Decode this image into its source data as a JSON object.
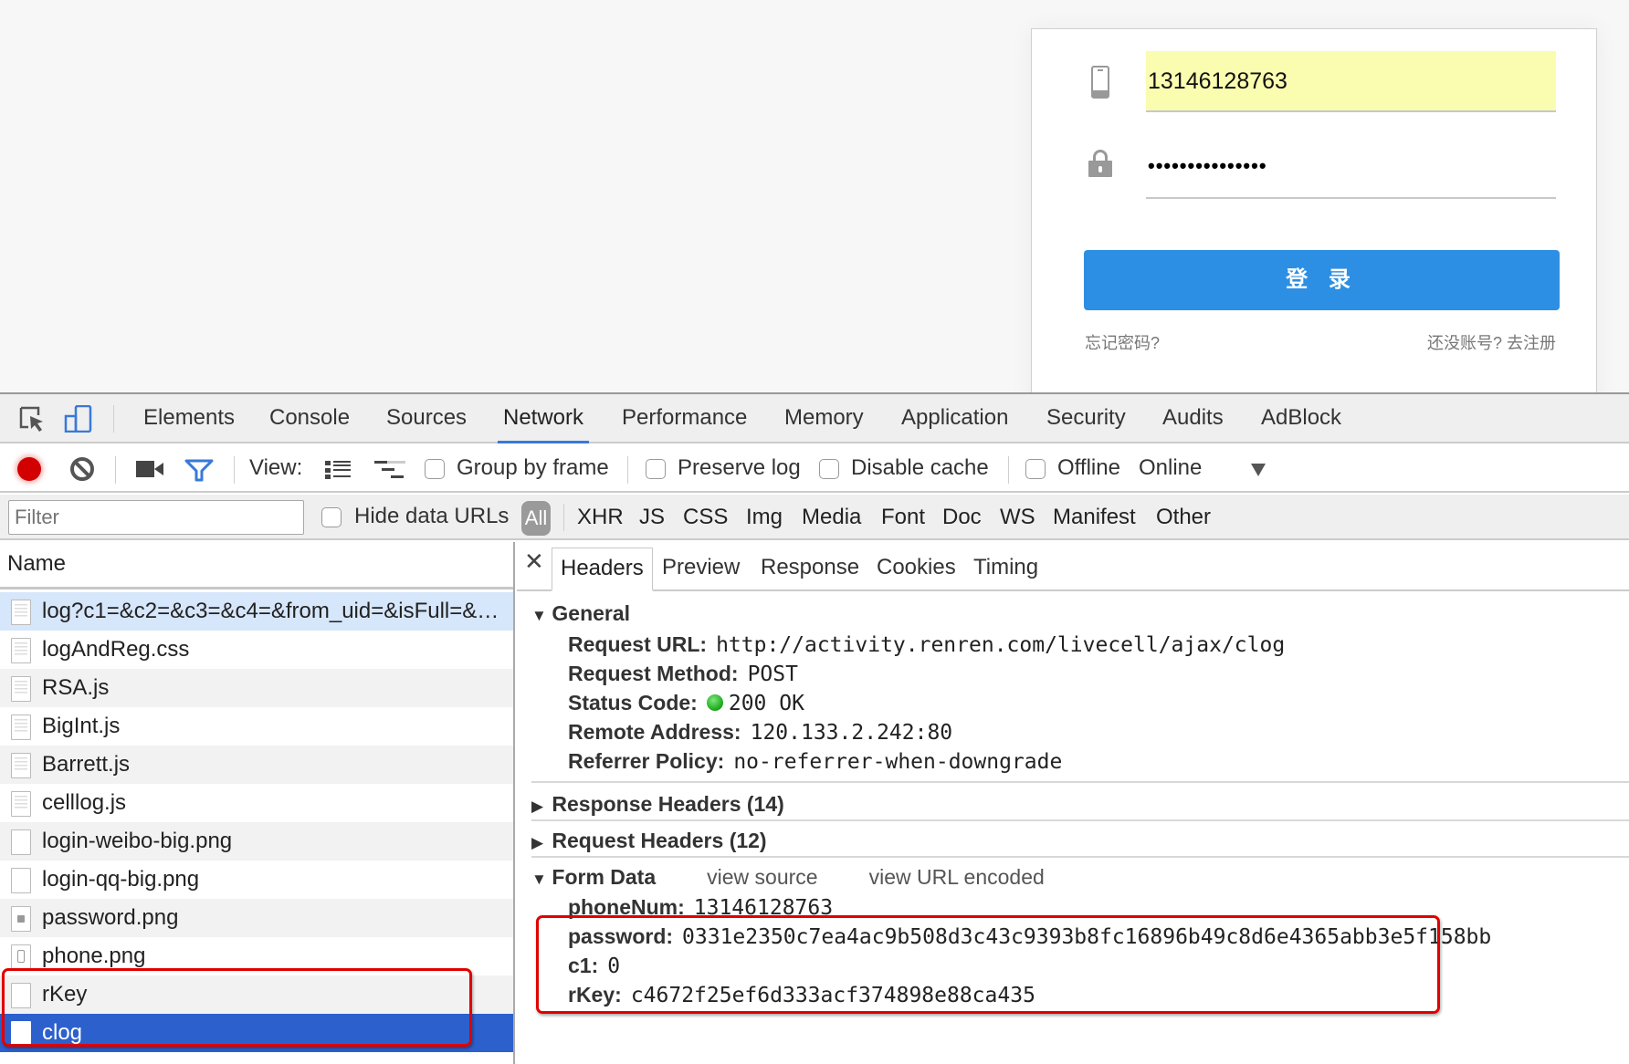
{
  "login": {
    "phone_value": "13146128763",
    "password_masked": "•••••••••••••••",
    "login_button": "登 录",
    "forgot_password": "忘记密码?",
    "register": "还没账号? 去注册",
    "input_highlight_color": "#fafcb0",
    "button_color": "#2d8fe3"
  },
  "devtools": {
    "tabs": [
      "Elements",
      "Console",
      "Sources",
      "Network",
      "Performance",
      "Memory",
      "Application",
      "Security",
      "Audits",
      "AdBlock"
    ],
    "active_tab": "Network",
    "toolbar": {
      "view_label": "View:",
      "group_by_frame": "Group by frame",
      "preserve_log": "Preserve log",
      "disable_cache": "Disable cache",
      "offline": "Offline",
      "throttle": "Online"
    },
    "filter": {
      "placeholder": "Filter",
      "hide_data_urls": "Hide data URLs",
      "types": [
        "All",
        "XHR",
        "JS",
        "CSS",
        "Img",
        "Media",
        "Font",
        "Doc",
        "WS",
        "Manifest",
        "Other"
      ],
      "active_type": "All"
    },
    "requests": {
      "column_header": "Name",
      "rows": [
        {
          "name": "log?c1=&c2=&c3=&c4=&from_uid=&isFull=&…",
          "icon": "doc"
        },
        {
          "name": "logAndReg.css",
          "icon": "doc"
        },
        {
          "name": "RSA.js",
          "icon": "doc"
        },
        {
          "name": "BigInt.js",
          "icon": "doc"
        },
        {
          "name": "Barrett.js",
          "icon": "doc"
        },
        {
          "name": "celllog.js",
          "icon": "doc"
        },
        {
          "name": "login-weibo-big.png",
          "icon": "blank"
        },
        {
          "name": "login-qq-big.png",
          "icon": "blank"
        },
        {
          "name": "password.png",
          "icon": "lock"
        },
        {
          "name": "phone.png",
          "icon": "phone"
        },
        {
          "name": "rKey",
          "icon": "blank"
        },
        {
          "name": "clog",
          "icon": "blank"
        }
      ],
      "selected": "clog"
    },
    "details": {
      "tabs": [
        "Headers",
        "Preview",
        "Response",
        "Cookies",
        "Timing"
      ],
      "active_tab": "Headers",
      "general": {
        "title": "General",
        "request_url_label": "Request URL:",
        "request_url": "http://activity.renren.com/livecell/ajax/clog",
        "request_method_label": "Request Method:",
        "request_method": "POST",
        "status_code_label": "Status Code:",
        "status_code": "200 OK",
        "status_color": "#17a617",
        "remote_address_label": "Remote Address:",
        "remote_address": "120.133.2.242:80",
        "referrer_policy_label": "Referrer Policy:",
        "referrer_policy": "no-referrer-when-downgrade"
      },
      "response_headers": "Response Headers (14)",
      "request_headers": "Request Headers (12)",
      "form_data": {
        "title": "Form Data",
        "view_source": "view source",
        "view_url_encoded": "view URL encoded",
        "fields": [
          {
            "key": "phoneNum:",
            "value": "13146128763"
          },
          {
            "key": "password:",
            "value": "0331e2350c7ea4ac9b508d3c43c9393b8fc16896b49c8d6e4365abb3e5f158bb"
          },
          {
            "key": "c1:",
            "value": "0"
          },
          {
            "key": "rKey:",
            "value": "c4672f25ef6d333acf374898e88ca435"
          }
        ]
      }
    }
  },
  "annotation_color": "#e00000"
}
